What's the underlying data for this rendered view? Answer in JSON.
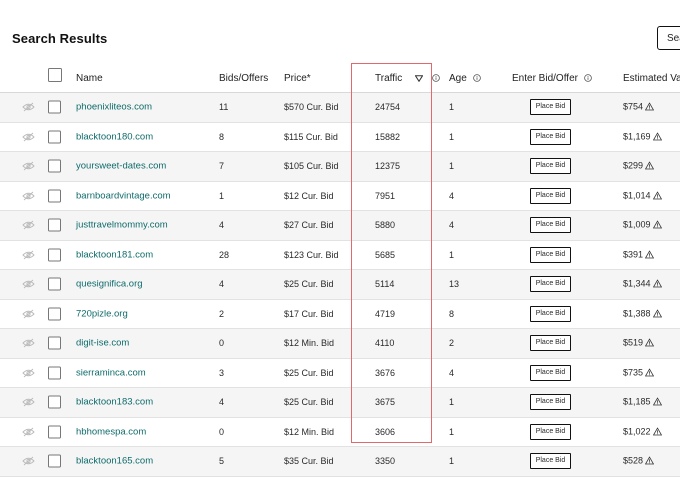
{
  "page": {
    "title": "Search Results",
    "top_button_label": "Sea"
  },
  "table": {
    "headers": {
      "name": "Name",
      "bids": "Bids/Offers",
      "price": "Price*",
      "traffic": "Traffic",
      "age": "Age",
      "enter_bid": "Enter Bid/Offer",
      "estimated_value": "Estimated Val"
    },
    "place_bid_label": "Place Bid",
    "rows": [
      {
        "domain": "phoenixliteos.com",
        "bids": "11",
        "price": "$570 Cur. Bid",
        "traffic": "24754",
        "age": "1",
        "estimated": "$754"
      },
      {
        "domain": "blacktoon180.com",
        "bids": "8",
        "price": "$115 Cur. Bid",
        "traffic": "15882",
        "age": "1",
        "estimated": "$1,169"
      },
      {
        "domain": "yoursweet-dates.com",
        "bids": "7",
        "price": "$105 Cur. Bid",
        "traffic": "12375",
        "age": "1",
        "estimated": "$299"
      },
      {
        "domain": "barnboardvintage.com",
        "bids": "1",
        "price": "$12 Cur. Bid",
        "traffic": "7951",
        "age": "4",
        "estimated": "$1,014"
      },
      {
        "domain": "justtravelmommy.com",
        "bids": "4",
        "price": "$27 Cur. Bid",
        "traffic": "5880",
        "age": "4",
        "estimated": "$1,009"
      },
      {
        "domain": "blacktoon181.com",
        "bids": "28",
        "price": "$123 Cur. Bid",
        "traffic": "5685",
        "age": "1",
        "estimated": "$391"
      },
      {
        "domain": "quesignifica.org",
        "bids": "4",
        "price": "$25 Cur. Bid",
        "traffic": "5114",
        "age": "13",
        "estimated": "$1,344"
      },
      {
        "domain": "720pizle.org",
        "bids": "2",
        "price": "$17 Cur. Bid",
        "traffic": "4719",
        "age": "8",
        "estimated": "$1,388"
      },
      {
        "domain": "digit-ise.com",
        "bids": "0",
        "price": "$12 Min. Bid",
        "traffic": "4110",
        "age": "2",
        "estimated": "$519"
      },
      {
        "domain": "sierraminca.com",
        "bids": "3",
        "price": "$25 Cur. Bid",
        "traffic": "3676",
        "age": "4",
        "estimated": "$735"
      },
      {
        "domain": "blacktoon183.com",
        "bids": "4",
        "price": "$25 Cur. Bid",
        "traffic": "3675",
        "age": "1",
        "estimated": "$1,185"
      },
      {
        "domain": "hbhomespa.com",
        "bids": "0",
        "price": "$12 Min. Bid",
        "traffic": "3606",
        "age": "1",
        "estimated": "$1,022"
      },
      {
        "domain": "blacktoon165.com",
        "bids": "5",
        "price": "$35 Cur. Bid",
        "traffic": "3350",
        "age": "1",
        "estimated": "$528"
      }
    ]
  },
  "colors": {
    "domain_link": "#0f6b6b",
    "highlight_border": "#e06a6a",
    "stripe": "#f5f5f5"
  },
  "icons": [
    "eye-slash-icon",
    "info-icon",
    "sort-down-icon",
    "warning-icon"
  ]
}
